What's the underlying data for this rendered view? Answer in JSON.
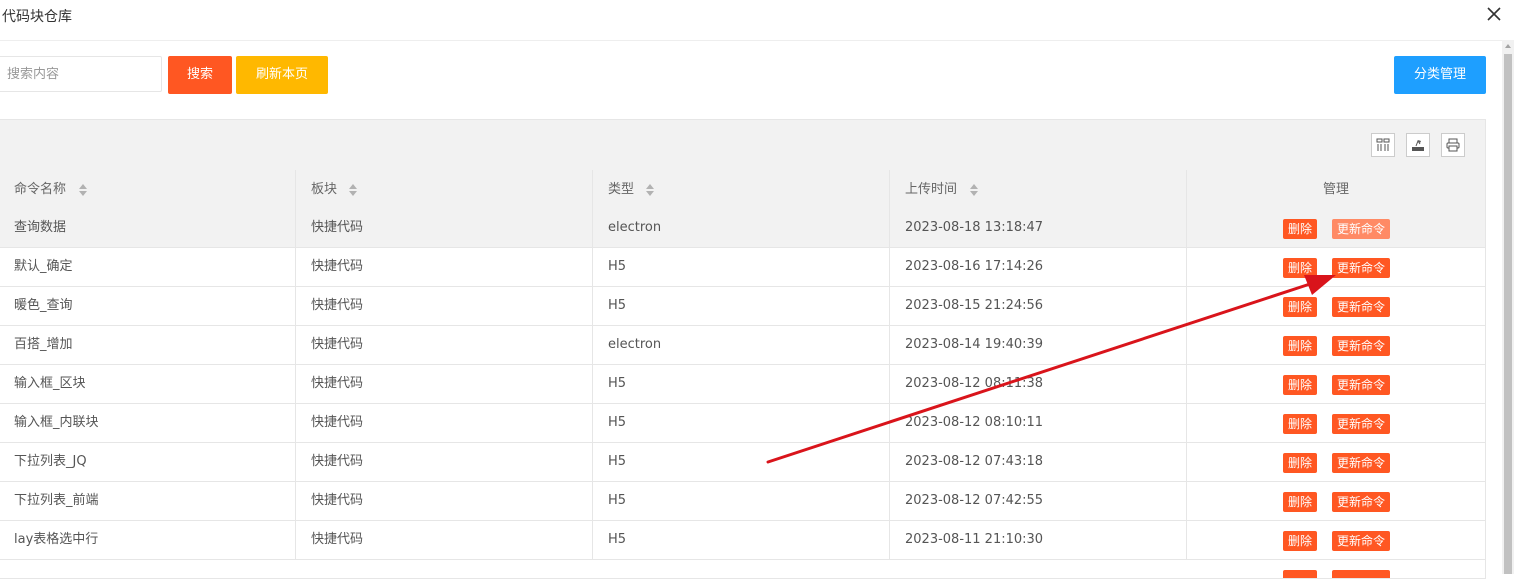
{
  "window": {
    "title": "代码块仓库",
    "close_icon": "close-icon"
  },
  "search": {
    "placeholder": "搜索内容",
    "value": ""
  },
  "buttons": {
    "search": "搜索",
    "refresh": "刷新本页",
    "category": "分类管理"
  },
  "toolbar": {
    "icons": [
      "columns-icon",
      "export-icon",
      "print-icon"
    ]
  },
  "table": {
    "headers": [
      "命令名称",
      "板块",
      "类型",
      "上传时间",
      "管理"
    ],
    "rows": [
      {
        "name": "查询数据",
        "block": "快捷代码",
        "type": "electron",
        "time": "2023-08-18 13:18:47"
      },
      {
        "name": "默认_确定",
        "block": "快捷代码",
        "type": "H5",
        "time": "2023-08-16 17:14:26"
      },
      {
        "name": "暖色_查询",
        "block": "快捷代码",
        "type": "H5",
        "time": "2023-08-15 21:24:56"
      },
      {
        "name": "百搭_增加",
        "block": "快捷代码",
        "type": "electron",
        "time": "2023-08-14 19:40:39"
      },
      {
        "name": "输入框_区块",
        "block": "快捷代码",
        "type": "H5",
        "time": "2023-08-12 08:11:38"
      },
      {
        "name": "输入框_内联块",
        "block": "快捷代码",
        "type": "H5",
        "time": "2023-08-12 08:10:11"
      },
      {
        "name": "下拉列表_JQ",
        "block": "快捷代码",
        "type": "H5",
        "time": "2023-08-12 07:43:18"
      },
      {
        "name": "下拉列表_前端",
        "block": "快捷代码",
        "type": "H5",
        "time": "2023-08-12 07:42:55"
      },
      {
        "name": "lay表格选中行",
        "block": "快捷代码",
        "type": "H5",
        "time": "2023-08-11 21:10:30"
      }
    ],
    "actions": {
      "delete": "删除",
      "update": "更新命令"
    }
  },
  "colors": {
    "search": "#ff5722",
    "refresh": "#ffb800",
    "category": "#1e9fff",
    "arrow": "#d9141b"
  }
}
